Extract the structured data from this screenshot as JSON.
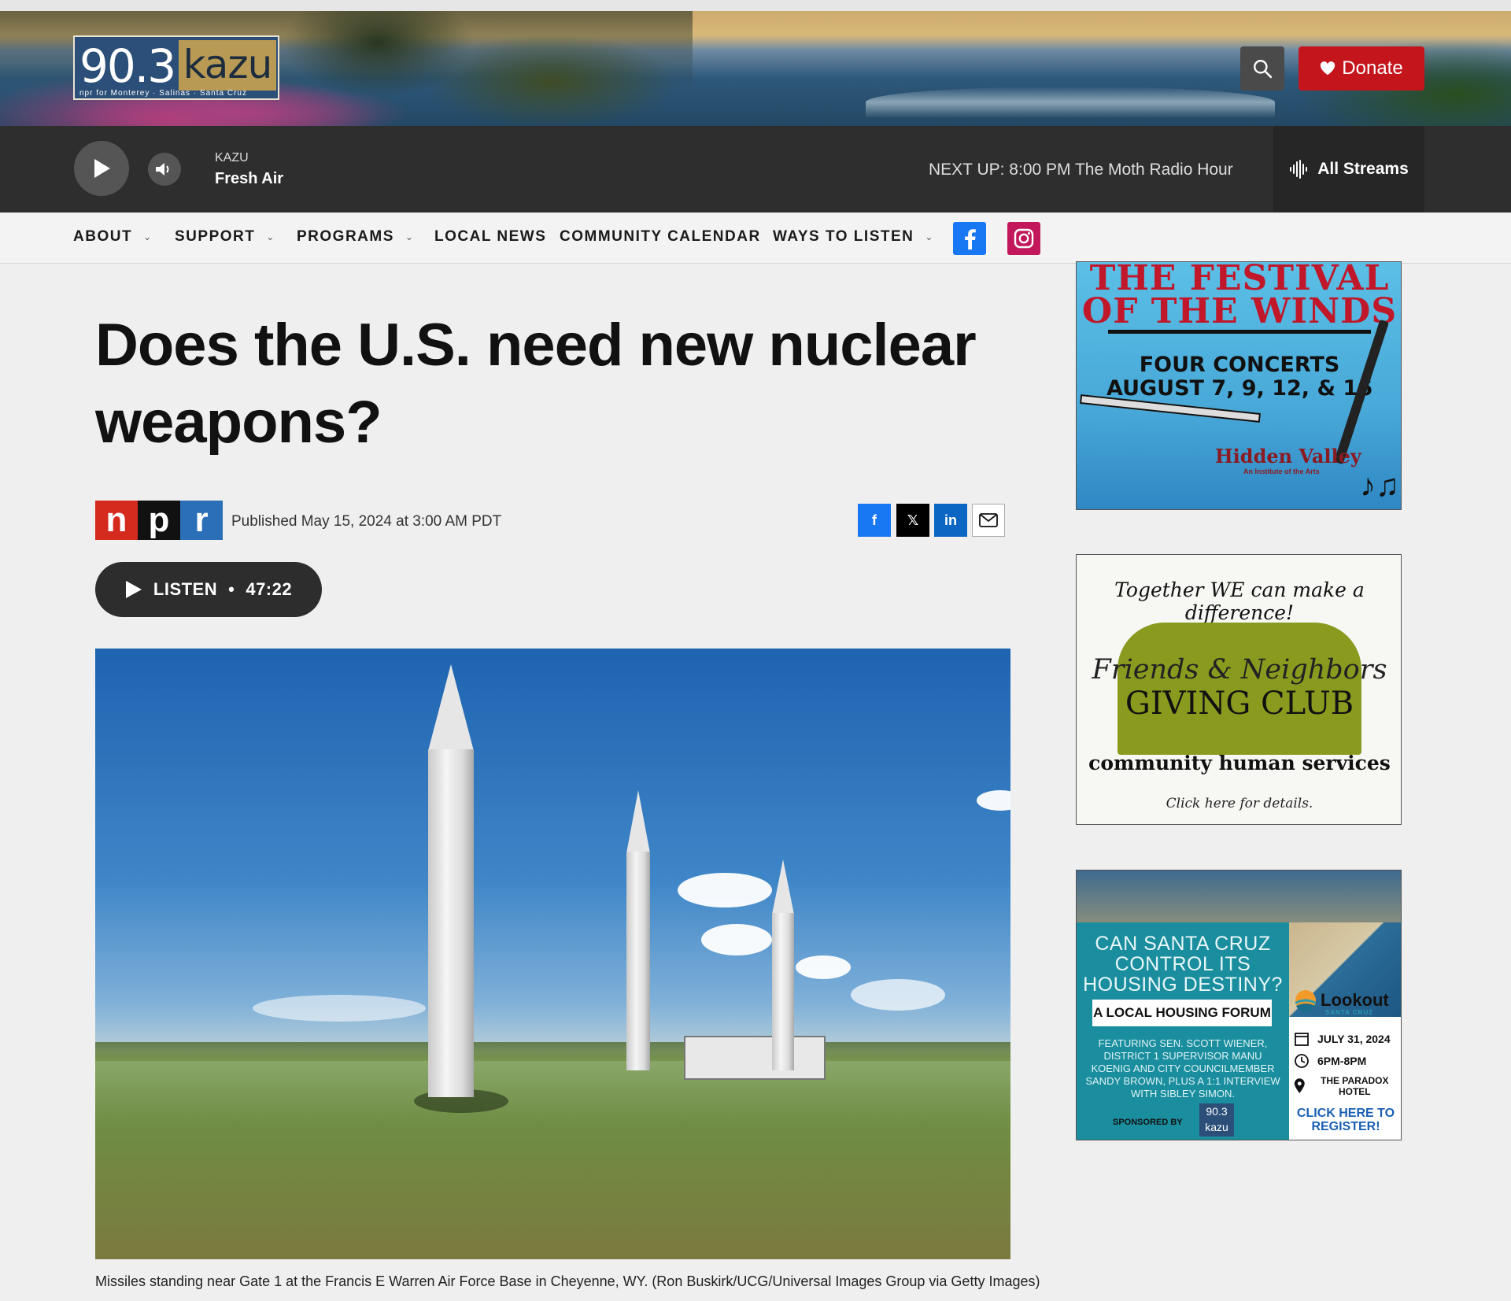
{
  "header": {
    "logo_number": "90.3",
    "logo_name": "kazu",
    "logo_tagline": "npr for Monterey · Salinas · Santa Cruz",
    "donate_label": "Donate"
  },
  "player": {
    "station": "KAZU",
    "show": "Fresh Air",
    "next_up": "NEXT UP: 8:00 PM The Moth Radio Hour",
    "all_streams": "All Streams"
  },
  "nav": {
    "items": [
      {
        "label": "ABOUT",
        "dropdown": true
      },
      {
        "label": "SUPPORT",
        "dropdown": true
      },
      {
        "label": "PROGRAMS",
        "dropdown": true
      },
      {
        "label": "LOCAL NEWS",
        "dropdown": false
      },
      {
        "label": "COMMUNITY CALENDAR",
        "dropdown": false
      },
      {
        "label": "WAYS TO LISTEN",
        "dropdown": true
      }
    ],
    "caret": "⌄",
    "social": [
      "facebook-icon",
      "instagram-icon"
    ]
  },
  "article": {
    "headline": "Does the U.S. need new nuclear weapons?",
    "source_letters": [
      "n",
      "p",
      "r"
    ],
    "published": "Published May 15, 2024 at 3:00 AM PDT",
    "share": {
      "facebook": "f",
      "x": "𝕏",
      "linkedin": "in"
    },
    "listen_label": "LISTEN",
    "listen_sep": "•",
    "duration": "47:22",
    "caption": "Missiles standing near Gate 1 at the Francis E Warren Air Force Base in Cheyenne, WY. (Ron Buskirk/UCG/Universal Images Group via Getty Images)"
  },
  "ads": {
    "ad1": {
      "title": "THE FESTIVAL OF THE WINDS",
      "line1": "FOUR CONCERTS",
      "line2": "AUGUST 7, 9, 12, & 16",
      "brand": "Hidden Valley",
      "brand_sub": "An Institute of the Arts",
      "notes": "♪♫"
    },
    "ad2": {
      "tagline": "Together WE can make a difference!",
      "script": "Friends & Neighbors",
      "club": "GIVING CLUB",
      "org": "community human services",
      "click": "Click here for details."
    },
    "ad3": {
      "headline": "CAN SANTA CRUZ CONTROL ITS HOUSING DESTINY?",
      "forum": "A LOCAL HOUSING FORUM",
      "body": "FEATURING SEN. SCOTT WIENER, DISTRICT 1 SUPERVISOR MANU KOENIG AND CITY COUNCILMEMBER SANDY BROWN, PLUS A 1:1 INTERVIEW WITH SIBLEY SIMON.",
      "sponsored_by": "SPONSORED BY",
      "kazu_num": "90.3",
      "kazu_name": "kazu",
      "lookout": "Lookout",
      "lookout_sub": "SANTA CRUZ",
      "date": "JULY 31, 2024",
      "time": "6PM-8PM",
      "venue": "THE PARADOX HOTEL",
      "cta": "CLICK HERE TO REGISTER!"
    }
  },
  "colors": {
    "donate": "#c4151c",
    "player_bg": "#2e2e2e",
    "facebook": "#1877f2",
    "instagram": "#c2185b",
    "linkedin": "#0a66c2"
  }
}
